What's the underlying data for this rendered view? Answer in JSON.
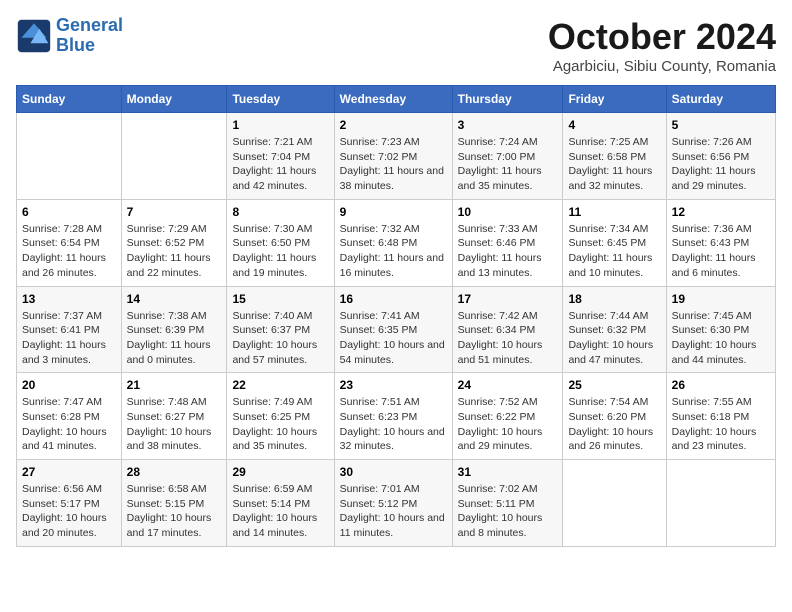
{
  "header": {
    "logo_line1": "General",
    "logo_line2": "Blue",
    "title": "October 2024",
    "subtitle": "Agarbiciu, Sibiu County, Romania"
  },
  "days_of_week": [
    "Sunday",
    "Monday",
    "Tuesday",
    "Wednesday",
    "Thursday",
    "Friday",
    "Saturday"
  ],
  "weeks": [
    [
      {
        "num": "",
        "sunrise": "",
        "sunset": "",
        "daylight": ""
      },
      {
        "num": "",
        "sunrise": "",
        "sunset": "",
        "daylight": ""
      },
      {
        "num": "1",
        "sunrise": "Sunrise: 7:21 AM",
        "sunset": "Sunset: 7:04 PM",
        "daylight": "Daylight: 11 hours and 42 minutes."
      },
      {
        "num": "2",
        "sunrise": "Sunrise: 7:23 AM",
        "sunset": "Sunset: 7:02 PM",
        "daylight": "Daylight: 11 hours and 38 minutes."
      },
      {
        "num": "3",
        "sunrise": "Sunrise: 7:24 AM",
        "sunset": "Sunset: 7:00 PM",
        "daylight": "Daylight: 11 hours and 35 minutes."
      },
      {
        "num": "4",
        "sunrise": "Sunrise: 7:25 AM",
        "sunset": "Sunset: 6:58 PM",
        "daylight": "Daylight: 11 hours and 32 minutes."
      },
      {
        "num": "5",
        "sunrise": "Sunrise: 7:26 AM",
        "sunset": "Sunset: 6:56 PM",
        "daylight": "Daylight: 11 hours and 29 minutes."
      }
    ],
    [
      {
        "num": "6",
        "sunrise": "Sunrise: 7:28 AM",
        "sunset": "Sunset: 6:54 PM",
        "daylight": "Daylight: 11 hours and 26 minutes."
      },
      {
        "num": "7",
        "sunrise": "Sunrise: 7:29 AM",
        "sunset": "Sunset: 6:52 PM",
        "daylight": "Daylight: 11 hours and 22 minutes."
      },
      {
        "num": "8",
        "sunrise": "Sunrise: 7:30 AM",
        "sunset": "Sunset: 6:50 PM",
        "daylight": "Daylight: 11 hours and 19 minutes."
      },
      {
        "num": "9",
        "sunrise": "Sunrise: 7:32 AM",
        "sunset": "Sunset: 6:48 PM",
        "daylight": "Daylight: 11 hours and 16 minutes."
      },
      {
        "num": "10",
        "sunrise": "Sunrise: 7:33 AM",
        "sunset": "Sunset: 6:46 PM",
        "daylight": "Daylight: 11 hours and 13 minutes."
      },
      {
        "num": "11",
        "sunrise": "Sunrise: 7:34 AM",
        "sunset": "Sunset: 6:45 PM",
        "daylight": "Daylight: 11 hours and 10 minutes."
      },
      {
        "num": "12",
        "sunrise": "Sunrise: 7:36 AM",
        "sunset": "Sunset: 6:43 PM",
        "daylight": "Daylight: 11 hours and 6 minutes."
      }
    ],
    [
      {
        "num": "13",
        "sunrise": "Sunrise: 7:37 AM",
        "sunset": "Sunset: 6:41 PM",
        "daylight": "Daylight: 11 hours and 3 minutes."
      },
      {
        "num": "14",
        "sunrise": "Sunrise: 7:38 AM",
        "sunset": "Sunset: 6:39 PM",
        "daylight": "Daylight: 11 hours and 0 minutes."
      },
      {
        "num": "15",
        "sunrise": "Sunrise: 7:40 AM",
        "sunset": "Sunset: 6:37 PM",
        "daylight": "Daylight: 10 hours and 57 minutes."
      },
      {
        "num": "16",
        "sunrise": "Sunrise: 7:41 AM",
        "sunset": "Sunset: 6:35 PM",
        "daylight": "Daylight: 10 hours and 54 minutes."
      },
      {
        "num": "17",
        "sunrise": "Sunrise: 7:42 AM",
        "sunset": "Sunset: 6:34 PM",
        "daylight": "Daylight: 10 hours and 51 minutes."
      },
      {
        "num": "18",
        "sunrise": "Sunrise: 7:44 AM",
        "sunset": "Sunset: 6:32 PM",
        "daylight": "Daylight: 10 hours and 47 minutes."
      },
      {
        "num": "19",
        "sunrise": "Sunrise: 7:45 AM",
        "sunset": "Sunset: 6:30 PM",
        "daylight": "Daylight: 10 hours and 44 minutes."
      }
    ],
    [
      {
        "num": "20",
        "sunrise": "Sunrise: 7:47 AM",
        "sunset": "Sunset: 6:28 PM",
        "daylight": "Daylight: 10 hours and 41 minutes."
      },
      {
        "num": "21",
        "sunrise": "Sunrise: 7:48 AM",
        "sunset": "Sunset: 6:27 PM",
        "daylight": "Daylight: 10 hours and 38 minutes."
      },
      {
        "num": "22",
        "sunrise": "Sunrise: 7:49 AM",
        "sunset": "Sunset: 6:25 PM",
        "daylight": "Daylight: 10 hours and 35 minutes."
      },
      {
        "num": "23",
        "sunrise": "Sunrise: 7:51 AM",
        "sunset": "Sunset: 6:23 PM",
        "daylight": "Daylight: 10 hours and 32 minutes."
      },
      {
        "num": "24",
        "sunrise": "Sunrise: 7:52 AM",
        "sunset": "Sunset: 6:22 PM",
        "daylight": "Daylight: 10 hours and 29 minutes."
      },
      {
        "num": "25",
        "sunrise": "Sunrise: 7:54 AM",
        "sunset": "Sunset: 6:20 PM",
        "daylight": "Daylight: 10 hours and 26 minutes."
      },
      {
        "num": "26",
        "sunrise": "Sunrise: 7:55 AM",
        "sunset": "Sunset: 6:18 PM",
        "daylight": "Daylight: 10 hours and 23 minutes."
      }
    ],
    [
      {
        "num": "27",
        "sunrise": "Sunrise: 6:56 AM",
        "sunset": "Sunset: 5:17 PM",
        "daylight": "Daylight: 10 hours and 20 minutes."
      },
      {
        "num": "28",
        "sunrise": "Sunrise: 6:58 AM",
        "sunset": "Sunset: 5:15 PM",
        "daylight": "Daylight: 10 hours and 17 minutes."
      },
      {
        "num": "29",
        "sunrise": "Sunrise: 6:59 AM",
        "sunset": "Sunset: 5:14 PM",
        "daylight": "Daylight: 10 hours and 14 minutes."
      },
      {
        "num": "30",
        "sunrise": "Sunrise: 7:01 AM",
        "sunset": "Sunset: 5:12 PM",
        "daylight": "Daylight: 10 hours and 11 minutes."
      },
      {
        "num": "31",
        "sunrise": "Sunrise: 7:02 AM",
        "sunset": "Sunset: 5:11 PM",
        "daylight": "Daylight: 10 hours and 8 minutes."
      },
      {
        "num": "",
        "sunrise": "",
        "sunset": "",
        "daylight": ""
      },
      {
        "num": "",
        "sunrise": "",
        "sunset": "",
        "daylight": ""
      }
    ]
  ]
}
